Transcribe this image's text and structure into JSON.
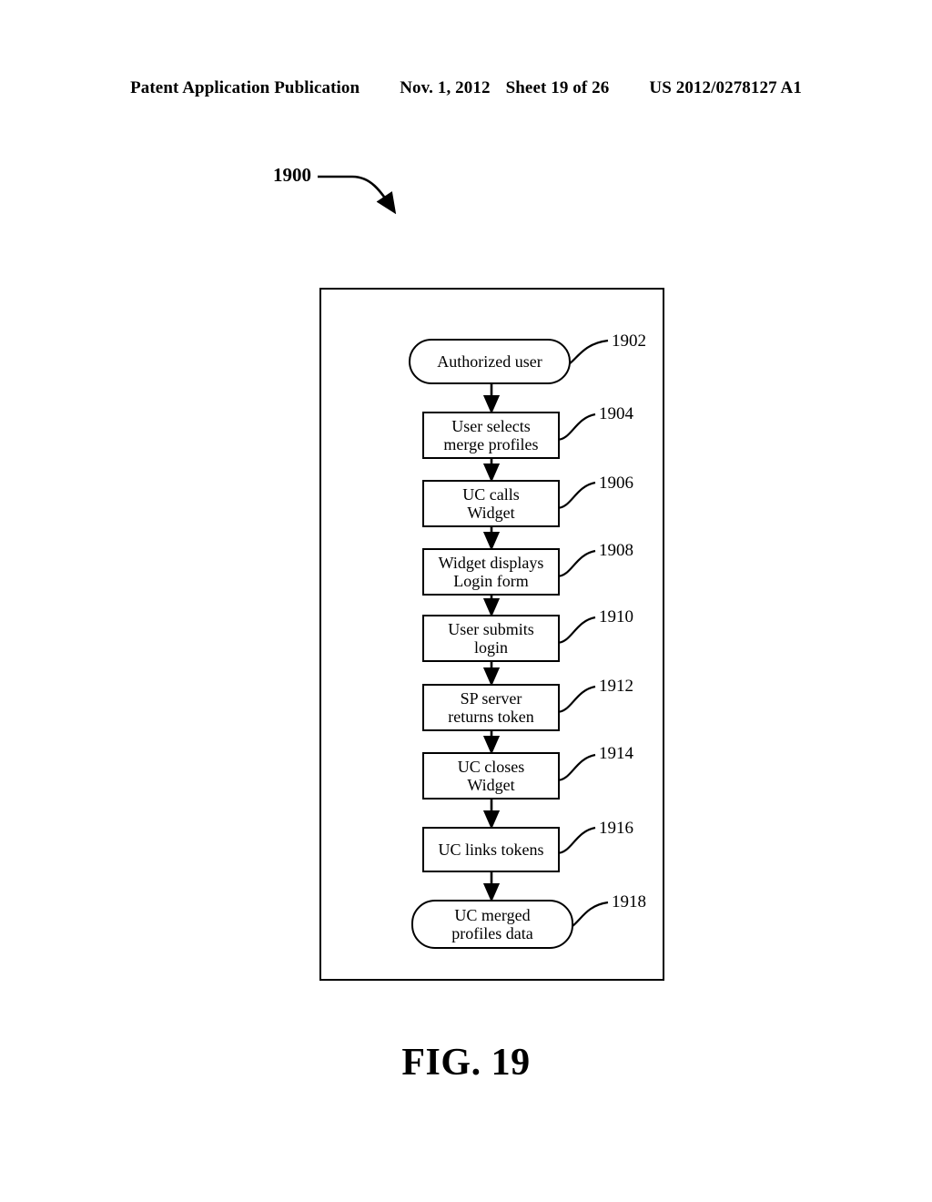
{
  "header": {
    "publication": "Patent Application Publication",
    "date": "Nov. 1, 2012",
    "sheet": "Sheet 19 of 26",
    "patent_number": "US 2012/0278127 A1"
  },
  "figure": {
    "caption": "FIG. 19",
    "reference_label": "1900"
  },
  "flowchart": {
    "nodes": [
      {
        "ref": "1902",
        "shape": "terminal",
        "line1": "Authorized user",
        "line2": ""
      },
      {
        "ref": "1904",
        "shape": "process",
        "line1": "User selects",
        "line2": "merge profiles"
      },
      {
        "ref": "1906",
        "shape": "process",
        "line1": "UC calls",
        "line2": "Widget"
      },
      {
        "ref": "1908",
        "shape": "process",
        "line1": "Widget displays",
        "line2": "Login form"
      },
      {
        "ref": "1910",
        "shape": "process",
        "line1": "User submits",
        "line2": "login"
      },
      {
        "ref": "1912",
        "shape": "process",
        "line1": "SP server",
        "line2": "returns token"
      },
      {
        "ref": "1914",
        "shape": "process",
        "line1": "UC closes",
        "line2": "Widget"
      },
      {
        "ref": "1916",
        "shape": "process",
        "line1": "UC links tokens",
        "line2": ""
      },
      {
        "ref": "1918",
        "shape": "terminal",
        "line1": "UC merged",
        "line2": "profiles data"
      }
    ]
  },
  "colors": {
    "ink": "#000000",
    "paper": "#ffffff"
  }
}
